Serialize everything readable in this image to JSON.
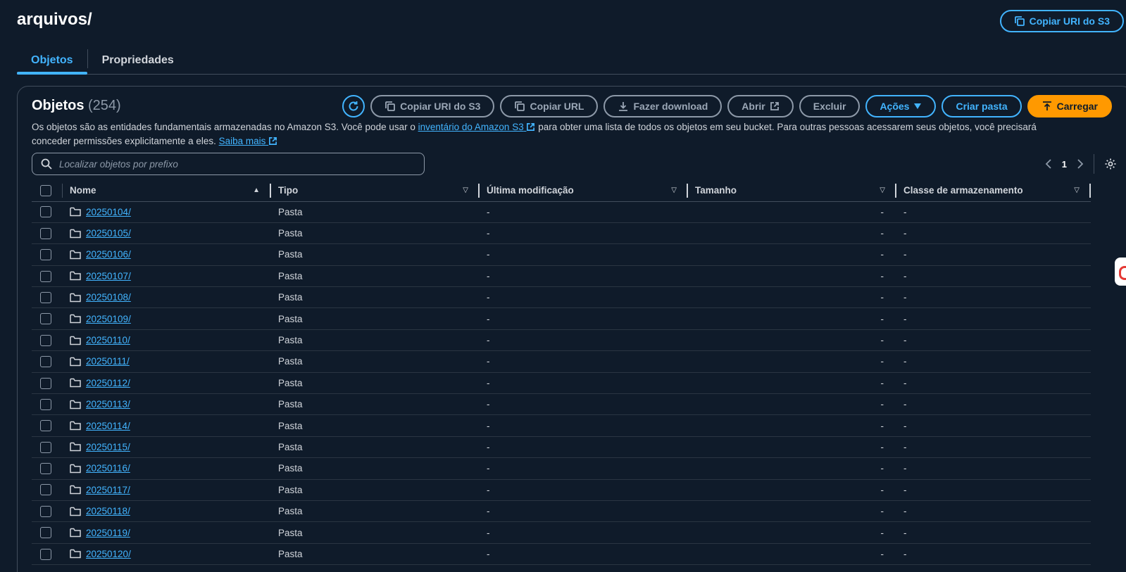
{
  "page": {
    "title": "arquivos/",
    "copy_uri_label": "Copiar URI do S3"
  },
  "tabs": [
    {
      "label": "Objetos",
      "active": true
    },
    {
      "label": "Propriedades",
      "active": false
    }
  ],
  "objects_panel": {
    "title": "Objetos",
    "count": "(254)",
    "actions": {
      "refresh_icon": "refresh-icon",
      "copy_uri": "Copiar URI do S3",
      "copy_url": "Copiar URL",
      "download": "Fazer download",
      "open": "Abrir",
      "delete": "Excluir",
      "actions_menu": "Ações",
      "create_folder": "Criar pasta",
      "upload": "Carregar"
    },
    "description": {
      "part1": "Os objetos são as entidades fundamentais armazenadas no Amazon S3. Você pode usar o ",
      "link1": "inventário do Amazon S3",
      "part2": " para obter uma lista de todos os objetos em seu bucket. Para outras pessoas acessarem seus objetos, você precisará conceder permissões explicitamente a eles. ",
      "link2": "Saiba mais"
    },
    "search": {
      "placeholder": "Localizar objetos por prefixo"
    },
    "pagination": {
      "current_page": "1"
    },
    "table": {
      "columns": {
        "name": "Nome",
        "type": "Tipo",
        "last_modified": "Última modificação",
        "size": "Tamanho",
        "storage_class": "Classe de armazenamento"
      },
      "rows": [
        {
          "name": "20250104/",
          "type": "Pasta",
          "last_modified": "-",
          "size": "-",
          "storage_class": "-"
        },
        {
          "name": "20250105/",
          "type": "Pasta",
          "last_modified": "-",
          "size": "-",
          "storage_class": "-"
        },
        {
          "name": "20250106/",
          "type": "Pasta",
          "last_modified": "-",
          "size": "-",
          "storage_class": "-"
        },
        {
          "name": "20250107/",
          "type": "Pasta",
          "last_modified": "-",
          "size": "-",
          "storage_class": "-"
        },
        {
          "name": "20250108/",
          "type": "Pasta",
          "last_modified": "-",
          "size": "-",
          "storage_class": "-"
        },
        {
          "name": "20250109/",
          "type": "Pasta",
          "last_modified": "-",
          "size": "-",
          "storage_class": "-"
        },
        {
          "name": "20250110/",
          "type": "Pasta",
          "last_modified": "-",
          "size": "-",
          "storage_class": "-"
        },
        {
          "name": "20250111/",
          "type": "Pasta",
          "last_modified": "-",
          "size": "-",
          "storage_class": "-"
        },
        {
          "name": "20250112/",
          "type": "Pasta",
          "last_modified": "-",
          "size": "-",
          "storage_class": "-"
        },
        {
          "name": "20250113/",
          "type": "Pasta",
          "last_modified": "-",
          "size": "-",
          "storage_class": "-"
        },
        {
          "name": "20250114/",
          "type": "Pasta",
          "last_modified": "-",
          "size": "-",
          "storage_class": "-"
        },
        {
          "name": "20250115/",
          "type": "Pasta",
          "last_modified": "-",
          "size": "-",
          "storage_class": "-"
        },
        {
          "name": "20250116/",
          "type": "Pasta",
          "last_modified": "-",
          "size": "-",
          "storage_class": "-"
        },
        {
          "name": "20250117/",
          "type": "Pasta",
          "last_modified": "-",
          "size": "-",
          "storage_class": "-"
        },
        {
          "name": "20250118/",
          "type": "Pasta",
          "last_modified": "-",
          "size": "-",
          "storage_class": "-"
        },
        {
          "name": "20250119/",
          "type": "Pasta",
          "last_modified": "-",
          "size": "-",
          "storage_class": "-"
        },
        {
          "name": "20250120/",
          "type": "Pasta",
          "last_modified": "-",
          "size": "-",
          "storage_class": "-"
        }
      ]
    }
  },
  "colors": {
    "background": "#0f1b2a",
    "accent": "#42b4ff",
    "primary_button": "#ff9900",
    "border": "#414d5c"
  }
}
